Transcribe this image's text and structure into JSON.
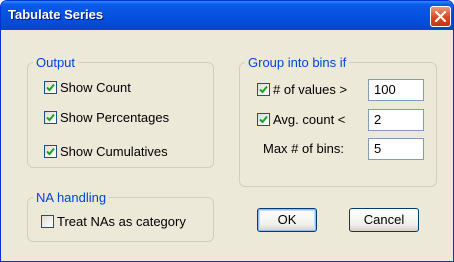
{
  "window": {
    "title": "Tabulate Series"
  },
  "output": {
    "legend": "Output",
    "options": [
      {
        "label": "Show Count",
        "checked": true
      },
      {
        "label": "Show Percentages",
        "checked": true
      },
      {
        "label": "Show Cumulatives",
        "checked": true
      }
    ]
  },
  "bins": {
    "legend": "Group into bins if",
    "num_values": {
      "label": "# of values >",
      "checked": true,
      "value": "100"
    },
    "avg_count": {
      "label": "Avg. count <",
      "checked": true,
      "value": "2"
    },
    "max_bins": {
      "label": "Max # of bins:",
      "value": "5"
    }
  },
  "na": {
    "legend": "NA handling",
    "treat_as_category": {
      "label": "Treat NAs as category",
      "checked": false
    }
  },
  "buttons": {
    "ok": "OK",
    "cancel": "Cancel"
  },
  "colors": {
    "title_bar": "#0550e0",
    "group_label": "#0046d5",
    "check_mark": "#21a121",
    "close_button": "#d8491e"
  },
  "icons": {
    "close": "close-x-icon",
    "check": "check-mark-icon"
  }
}
